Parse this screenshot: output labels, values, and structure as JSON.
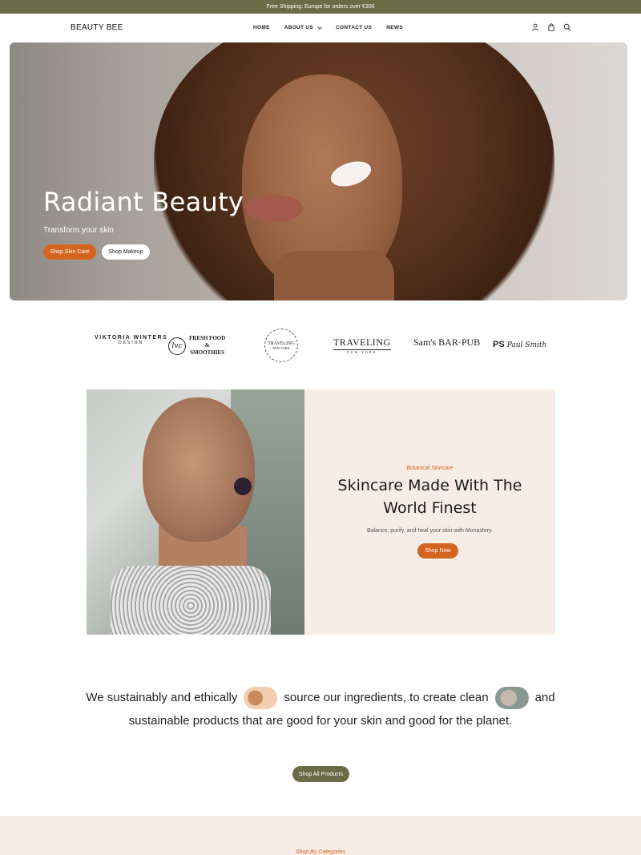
{
  "announcement": "Free Shipping: Europe for orders over €300",
  "header": {
    "logo": "BEAUTY BEE",
    "nav": [
      {
        "label": "HOME",
        "active": true
      },
      {
        "label": "ABOUT US",
        "dropdown": true
      },
      {
        "label": "CONTACT US"
      },
      {
        "label": "NEWS"
      }
    ],
    "icons": [
      "user-icon",
      "bag-icon",
      "search-icon"
    ]
  },
  "hero": {
    "title": "Radiant Beauty",
    "subtitle": "Transform your skin",
    "primary_button": "Shop Skin Care",
    "secondary_button": "Shop Makeup"
  },
  "brands": {
    "viktoria": {
      "name": "VIKTORIA WINTERS",
      "sub": "DESIGN"
    },
    "fresh": {
      "mark": "lvc",
      "line1": "FRESH FOOD",
      "line2": "&",
      "line3": "SMOOTHIES"
    },
    "traveling_round": {
      "name": "TRAVELING",
      "sub": "NEW YORK"
    },
    "traveling": {
      "name": "TRAVELING",
      "sub": "NEW YORK"
    },
    "sams": {
      "name": "Sam's BAR·PUB"
    },
    "ps": {
      "initials": "PS",
      "script": "Paul Smith"
    }
  },
  "feature": {
    "eyebrow": "Botanical Skincare",
    "title": "Skincare Made With The World Finest",
    "description": "Balance, purify, and heal your skin with Monastery.",
    "button": "Shop Now"
  },
  "mission": {
    "part1": "We sustainably and ethically",
    "part2": "source our ingredients, to create clean",
    "part3": "and sustainable products that are good for your skin and good for the planet.",
    "button": "Shop All Products"
  },
  "categories": {
    "eyebrow": "Shop By Categories"
  },
  "colors": {
    "accent": "#d4641e",
    "olive": "#6a6b47",
    "blush": "#f8ece6"
  }
}
